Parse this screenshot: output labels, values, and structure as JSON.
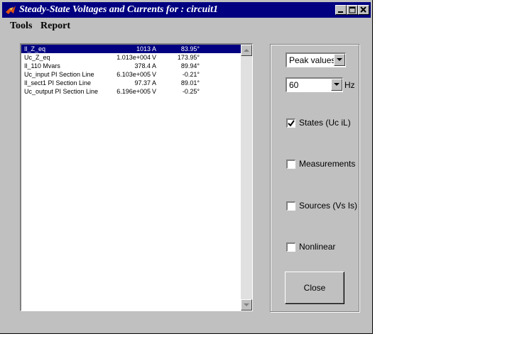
{
  "window": {
    "title": "Steady-State Voltages and Currents for : circuit1"
  },
  "menu": [
    "Tools",
    "Report"
  ],
  "list": {
    "rows": [
      {
        "name": "Il_Z_eq",
        "value": "1013",
        "unit": "A",
        "angle": "83.95°",
        "selected": true
      },
      {
        "name": "Uc_Z_eq",
        "value": "1.013e+004",
        "unit": "V",
        "angle": "173.95°",
        "selected": false
      },
      {
        "name": "Il_110 Mvars",
        "value": "378.4",
        "unit": "A",
        "angle": "89.94°",
        "selected": false
      },
      {
        "name": "Uc_input PI Section Line",
        "value": "6.103e+005",
        "unit": "V",
        "angle": "-0.21°",
        "selected": false
      },
      {
        "name": "Il_sect1 PI Section Line",
        "value": "97.37",
        "unit": "A",
        "angle": "89.01°",
        "selected": false
      },
      {
        "name": "Uc_output PI Section Line",
        "value": "6.196e+005",
        "unit": "V",
        "angle": "-0.25°",
        "selected": false
      }
    ]
  },
  "controls": {
    "values_mode": "Peak values",
    "frequency": "60",
    "frequency_unit": "Hz",
    "checks": [
      {
        "label": "States  (Uc iL)",
        "checked": true
      },
      {
        "label": "Measurements",
        "checked": false
      },
      {
        "label": "Sources (Vs Is)",
        "checked": false
      },
      {
        "label": "Nonlinear",
        "checked": false
      }
    ],
    "close_label": "Close"
  }
}
